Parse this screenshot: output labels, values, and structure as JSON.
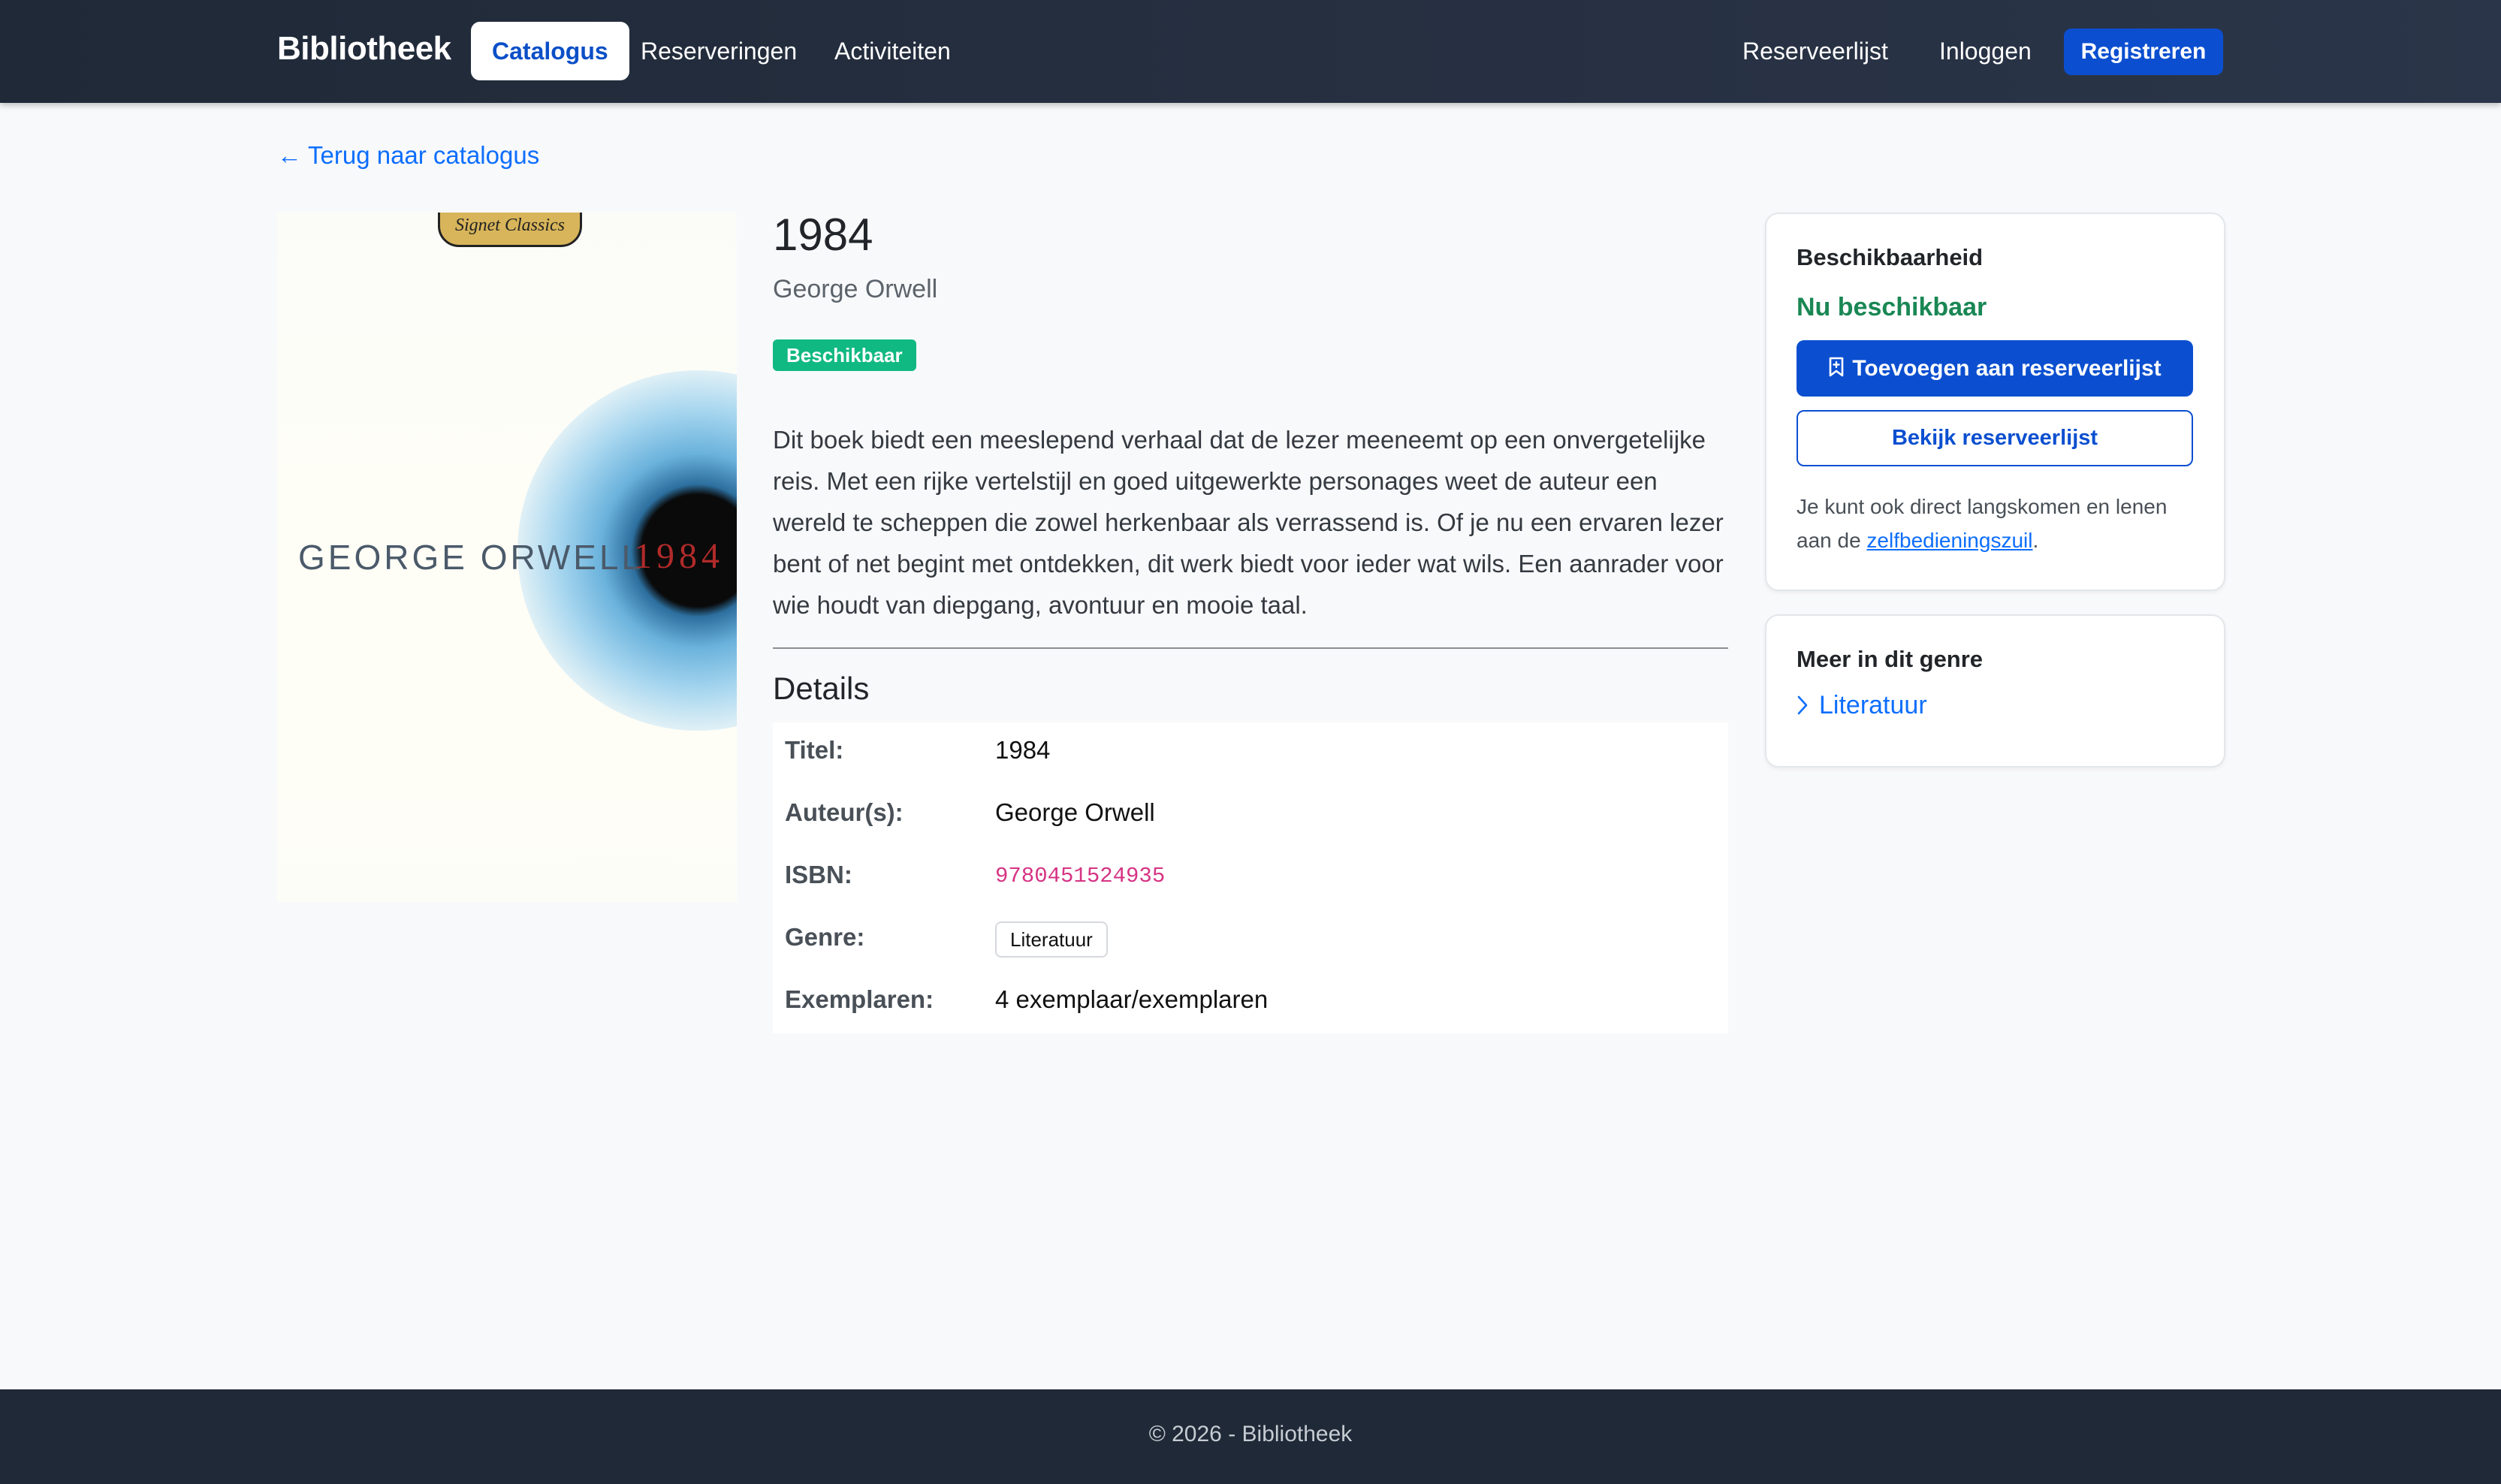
{
  "navbar": {
    "brand": "Bibliotheek",
    "links": [
      {
        "label": "Catalogus"
      },
      {
        "label": "Reserveringen"
      },
      {
        "label": "Activiteiten"
      }
    ],
    "right_links": [
      {
        "label": "Reserveerlijst"
      },
      {
        "label": "Inloggen"
      }
    ],
    "register_label": "Registreren"
  },
  "back_link": {
    "label": "Terug naar catalogus"
  },
  "cover": {
    "publisher_label": "Signet Classics",
    "author_text": "GEORGE ORWELL",
    "title_text": "1984"
  },
  "book": {
    "title": "1984",
    "author": "George Orwell",
    "status_badge": "Beschikbaar",
    "description": "Dit boek biedt een meeslepend verhaal dat de lezer meeneemt op een onvergetelijke reis. Met een rijke vertelstijl en goed uitgewerkte personages weet de auteur een wereld te scheppen die zowel herkenbaar als verrassend is. Of je nu een ervaren lezer bent of net begint met ontdekken, dit werk biedt voor ieder wat wils. Een aanrader voor wie houdt van diepgang, avontuur en mooie taal."
  },
  "details": {
    "heading": "Details",
    "rows": [
      {
        "label": "Titel:",
        "value": "1984"
      },
      {
        "label": "Auteur(s):",
        "value": "George Orwell"
      },
      {
        "label": "ISBN:",
        "value": "9780451524935"
      },
      {
        "label": "Genre:",
        "value": "Literatuur"
      },
      {
        "label": "Exemplaren:",
        "value": "4 exemplaar/exemplaren"
      }
    ]
  },
  "availability": {
    "title": "Beschikbaarheid",
    "status": "Nu beschikbaar",
    "add_button": "Toevoegen aan reserveerlijst",
    "view_button": "Bekijk reserveerlijst",
    "note_prefix": "Je kunt ook direct langskomen en lenen aan de ",
    "note_link": "zelfbedieningszuil",
    "note_suffix": "."
  },
  "genre_card": {
    "title": "Meer in dit genre",
    "link": "Literatuur"
  },
  "footer": {
    "text": "© 2026 - Bibliotheek"
  },
  "colors": {
    "navbar": "#1f2937",
    "primary": "#0b4fd0",
    "link": "#0d6efd",
    "success_badge": "#10b981",
    "success_text": "#198754",
    "isbn": "#d63384"
  }
}
